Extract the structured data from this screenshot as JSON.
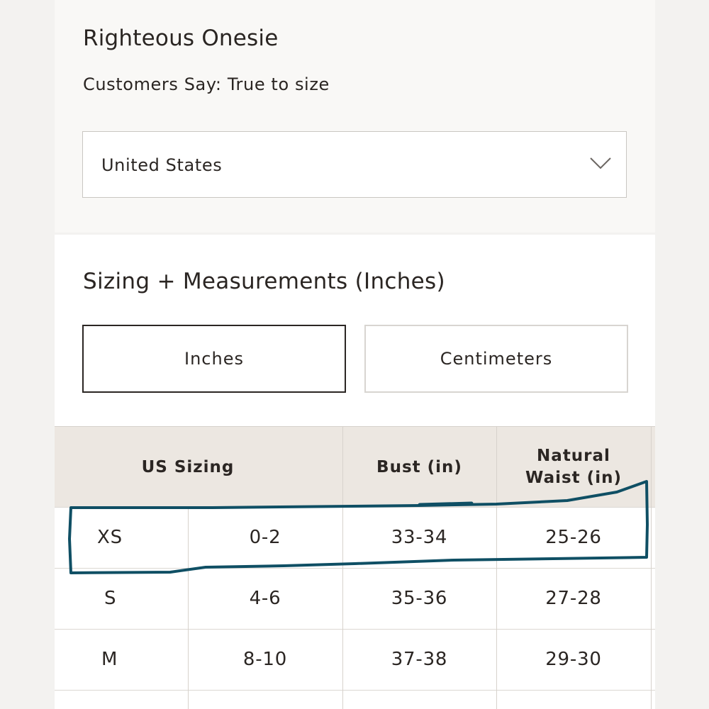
{
  "product": {
    "title": "Righteous Onesie",
    "fit_note": "Customers Say: True to size"
  },
  "country_select": {
    "value": "United States",
    "icon": "chevron-down-icon"
  },
  "sizing": {
    "title": "Sizing + Measurements (Inches)",
    "units": [
      {
        "label": "Inches",
        "selected": true
      },
      {
        "label": "Centimeters",
        "selected": false
      }
    ]
  },
  "table": {
    "headers": {
      "us_sizing": "US Sizing",
      "bust": "Bust (in)",
      "waist_line1": "Natural",
      "waist_line2": "Waist (in)"
    },
    "rows": [
      {
        "size": "XS",
        "us": "0-2",
        "bust": "33-34",
        "waist": "25-26",
        "highlighted": true
      },
      {
        "size": "S",
        "us": "4-6",
        "bust": "35-36",
        "waist": "27-28",
        "highlighted": false
      },
      {
        "size": "M",
        "us": "8-10",
        "bust": "37-38",
        "waist": "29-30",
        "highlighted": false
      }
    ]
  },
  "annotation": {
    "color": "#0f4f64"
  }
}
